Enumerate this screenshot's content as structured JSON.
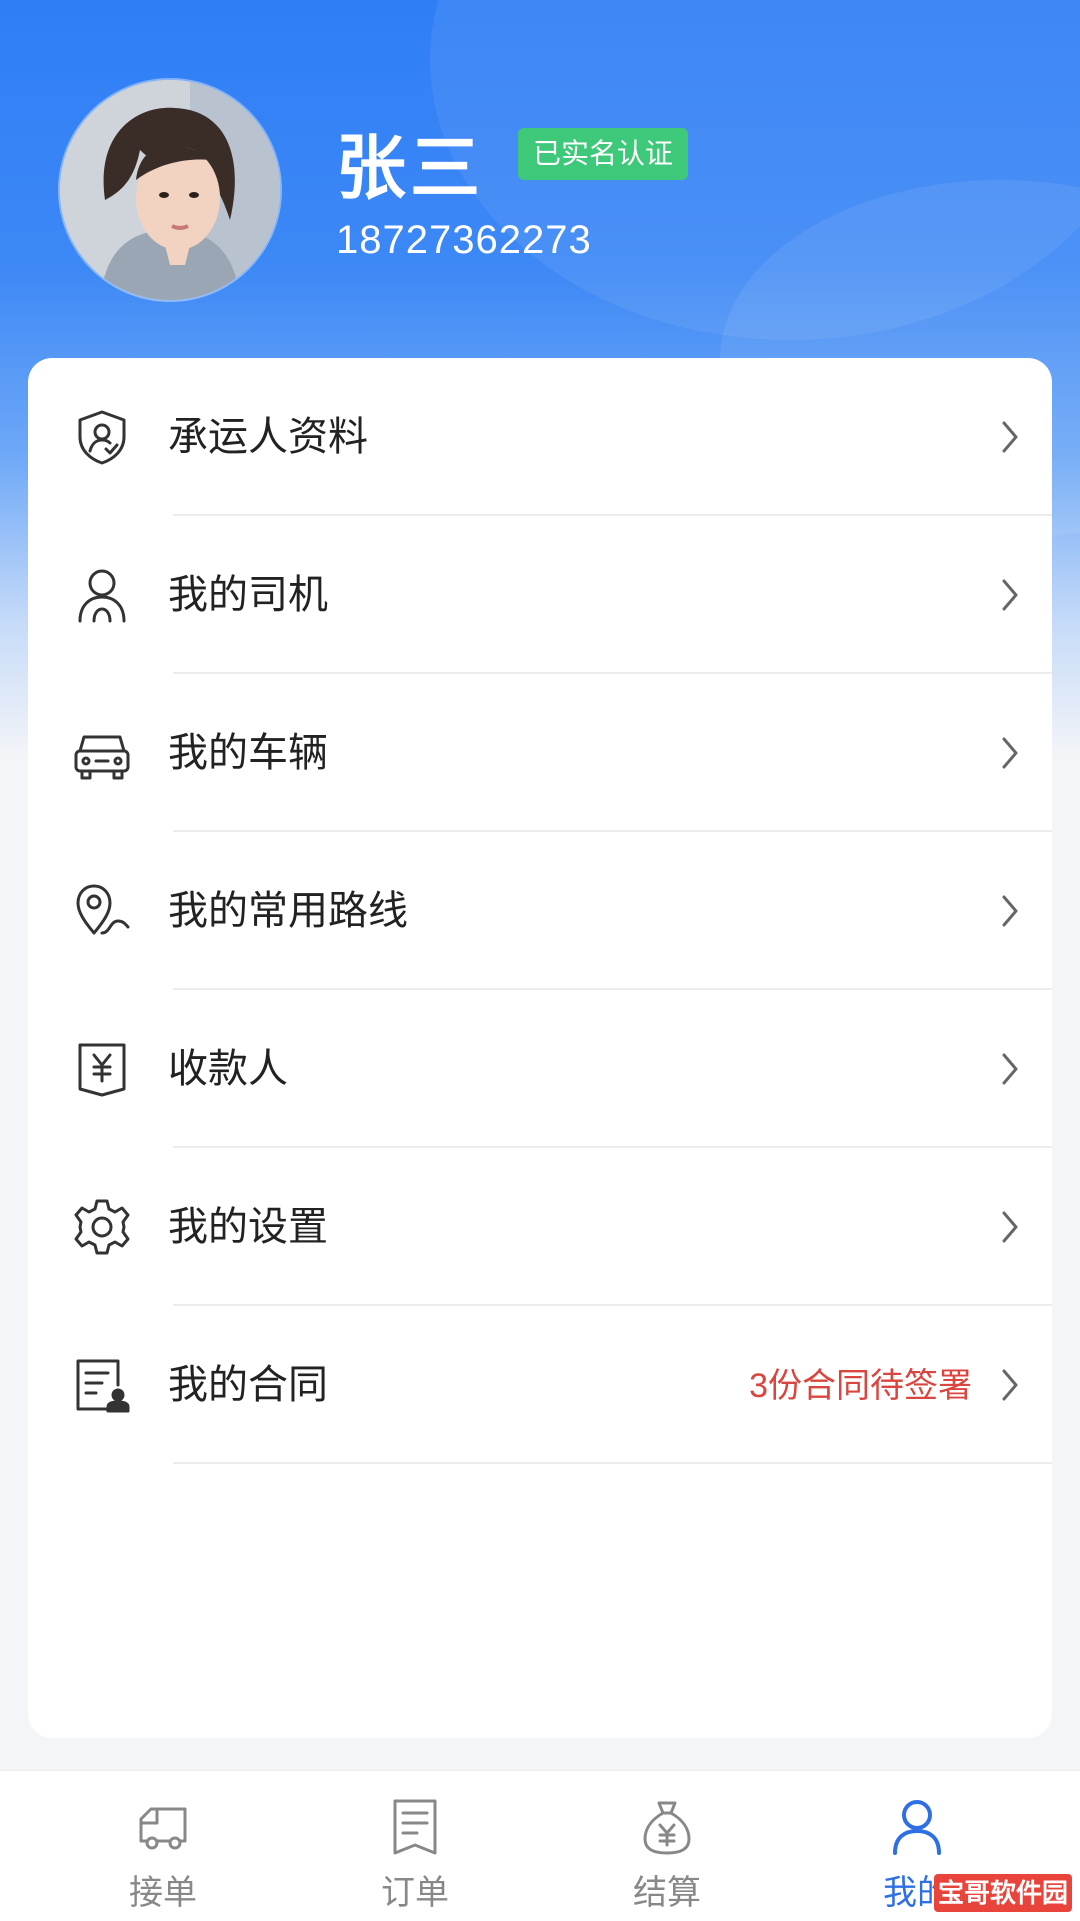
{
  "profile": {
    "name": "张三",
    "verified_badge": "已实名认证",
    "phone": "18727362273"
  },
  "menu": [
    {
      "label": "承运人资料",
      "icon": "shield-user-icon"
    },
    {
      "label": "我的司机",
      "icon": "driver-user-icon"
    },
    {
      "label": "我的车辆",
      "icon": "car-icon"
    },
    {
      "label": "我的常用路线",
      "icon": "route-pin-icon"
    },
    {
      "label": "收款人",
      "icon": "yen-wallet-icon"
    },
    {
      "label": "我的设置",
      "icon": "gear-icon"
    },
    {
      "label": "我的合同",
      "icon": "contract-icon",
      "extra": "3份合同待签署"
    }
  ],
  "tabs": [
    {
      "label": "接单",
      "icon": "truck-icon"
    },
    {
      "label": "订单",
      "icon": "order-list-icon"
    },
    {
      "label": "结算",
      "icon": "money-bag-icon"
    },
    {
      "label": "我的",
      "icon": "user-icon",
      "active": true
    }
  ],
  "watermark": "宝哥软件园",
  "colors": {
    "primary_blue": "#2f7ef6",
    "badge_green": "#3ec879",
    "alert_red": "#d8463f",
    "tab_active": "#2f6fe4"
  }
}
